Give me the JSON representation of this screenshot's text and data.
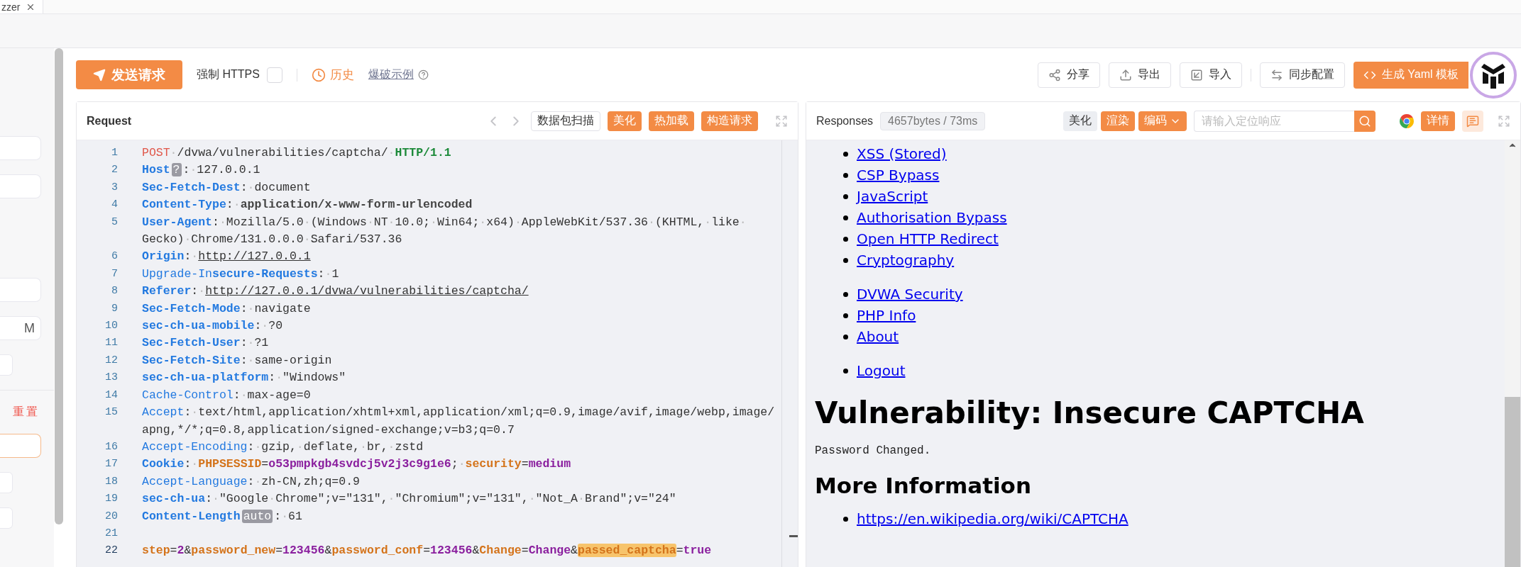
{
  "tab_strip": {
    "tabs": [
      {
        "label": "zzer",
        "selected": true
      }
    ]
  },
  "sidebar": {
    "sections": [
      {
        "items": [
          {
            "kind": "field",
            "focused": false
          },
          {
            "kind": "field",
            "focused": false
          }
        ]
      },
      {
        "items": [
          {
            "kind": "field",
            "focused": false
          },
          {
            "kind": "field",
            "value": "M",
            "focused": false
          },
          {
            "kind": "button"
          }
        ]
      },
      {
        "items": [
          {
            "kind": "link",
            "text": "重置"
          },
          {
            "kind": "field",
            "focused": true
          },
          {
            "kind": "button"
          },
          {
            "kind": "button"
          }
        ]
      }
    ]
  },
  "toolbar": {
    "send_button": "发送请求",
    "force_https": {
      "label": "强制 HTTPS",
      "checked": false
    },
    "history": "历史",
    "examples_link": "爆破示例",
    "actions": [
      {
        "label": "分享",
        "kind": "share"
      },
      {
        "label": "导出",
        "kind": "export"
      },
      {
        "label": "导入",
        "kind": "import"
      },
      {
        "label": "同步配置",
        "kind": "sync"
      }
    ],
    "generate_button": "生成 Yaml 模板"
  },
  "request": {
    "title": "Request",
    "buttons": [
      {
        "label": "数据包扫描",
        "kind": "outline"
      },
      {
        "label": "美化",
        "kind": "primary"
      },
      {
        "label": "热加载",
        "kind": "primary"
      },
      {
        "label": "构造请求",
        "kind": "primary"
      }
    ],
    "lines": [
      {
        "num": "1",
        "active": false,
        "rows": [
          [
            {
              "kind": "method",
              "text": "POST"
            },
            {
              "kind": "val",
              "text": "·/dvwa/vulnerabilities/captcha/·"
            },
            {
              "kind": "proto",
              "text": "HTTP/1.1"
            }
          ]
        ]
      },
      {
        "num": "2",
        "active": false,
        "rows": [
          [
            {
              "kind": "key",
              "text": "Host"
            },
            {
              "kind": "badge",
              "text": "?"
            },
            {
              "kind": "val",
              "text": ":·127.0.0.1"
            }
          ]
        ]
      },
      {
        "num": "3",
        "active": false,
        "rows": [
          [
            {
              "kind": "key",
              "text": "Sec-Fetch-Dest"
            },
            {
              "kind": "val",
              "text": ":·document"
            }
          ]
        ]
      },
      {
        "num": "4",
        "active": false,
        "rows": [
          [
            {
              "kind": "key",
              "text": "Content-Type"
            },
            {
              "kind": "val",
              "text": ":·"
            },
            {
              "kind": "strong",
              "text": "application/x-www-form-urlencoded"
            }
          ]
        ]
      },
      {
        "num": "5",
        "active": false,
        "rows": [
          [
            {
              "kind": "key",
              "text": "User-Agent"
            },
            {
              "kind": "val",
              "text": ":·Mozilla/5.0·(Windows·NT·10.0;·Win64;·x64)·AppleWebKit/537.36·(KHTML,·like·"
            }
          ],
          [
            {
              "kind": "val",
              "text": "Gecko)·Chrome/131.0.0.0·Safari/537.36"
            }
          ]
        ]
      },
      {
        "num": "6",
        "active": false,
        "rows": [
          [
            {
              "kind": "key",
              "text": "Origin"
            },
            {
              "kind": "val",
              "text": ":·"
            },
            {
              "kind": "link",
              "text": "http://127.0.0.1"
            }
          ]
        ]
      },
      {
        "num": "7",
        "active": false,
        "rows": [
          [
            {
              "kind": "key-plain",
              "text": "Upgrade-In"
            },
            {
              "kind": "key",
              "text": "secure-Requests"
            },
            {
              "kind": "val",
              "text": ":·1"
            }
          ]
        ]
      },
      {
        "num": "8",
        "active": false,
        "rows": [
          [
            {
              "kind": "key",
              "text": "Referer"
            },
            {
              "kind": "val",
              "text": ":·"
            },
            {
              "kind": "link",
              "text": "http://127.0.0.1/dvwa/vulnerabilities/captcha/"
            }
          ]
        ]
      },
      {
        "num": "9",
        "active": false,
        "rows": [
          [
            {
              "kind": "key",
              "text": "Sec-Fetch-Mode"
            },
            {
              "kind": "val",
              "text": ":·navigate"
            }
          ]
        ]
      },
      {
        "num": "10",
        "active": false,
        "rows": [
          [
            {
              "kind": "key",
              "text": "sec-ch-ua-mobile"
            },
            {
              "kind": "val",
              "text": ":·?0"
            }
          ]
        ]
      },
      {
        "num": "11",
        "active": false,
        "rows": [
          [
            {
              "kind": "key",
              "text": "Sec-Fetch-User"
            },
            {
              "kind": "val",
              "text": ":·?1"
            }
          ]
        ]
      },
      {
        "num": "12",
        "active": false,
        "rows": [
          [
            {
              "kind": "key",
              "text": "Sec-Fetch-Site"
            },
            {
              "kind": "val",
              "text": ":·same-origin"
            }
          ]
        ]
      },
      {
        "num": "13",
        "active": false,
        "rows": [
          [
            {
              "kind": "key",
              "text": "sec-ch-ua-platform"
            },
            {
              "kind": "val",
              "text": ":·\"Windows\""
            }
          ]
        ]
      },
      {
        "num": "14",
        "active": false,
        "rows": [
          [
            {
              "kind": "key-plain",
              "text": "Cache-Control"
            },
            {
              "kind": "val",
              "text": ":·max-age=0"
            }
          ]
        ]
      },
      {
        "num": "15",
        "active": false,
        "rows": [
          [
            {
              "kind": "key-plain",
              "text": "Accept"
            },
            {
              "kind": "val",
              "text": ":·text/html,application/xhtml+xml,application/xml;q=0.9,image/avif,image/webp,image/"
            }
          ],
          [
            {
              "kind": "val",
              "text": "apng,*/*;q=0.8,application/signed-exchange;v=b3;q=0.7"
            }
          ]
        ]
      },
      {
        "num": "16",
        "active": false,
        "rows": [
          [
            {
              "kind": "key-plain",
              "text": "Accept-Encoding"
            },
            {
              "kind": "val",
              "text": ":·gzip,·deflate,·br,·zstd"
            }
          ]
        ]
      },
      {
        "num": "17",
        "active": false,
        "rows": [
          [
            {
              "kind": "key",
              "text": "Cookie"
            },
            {
              "kind": "val",
              "text": ":·"
            },
            {
              "kind": "param",
              "text": "PHPSESSID"
            },
            {
              "kind": "val",
              "text": "="
            },
            {
              "kind": "value",
              "text": "o53pmpkgb4svdcj5v2j3c9g1e6"
            },
            {
              "kind": "val",
              "text": ";·"
            },
            {
              "kind": "param",
              "text": "security"
            },
            {
              "kind": "val",
              "text": "="
            },
            {
              "kind": "value",
              "text": "medium"
            }
          ]
        ]
      },
      {
        "num": "18",
        "active": false,
        "rows": [
          [
            {
              "kind": "key-plain",
              "text": "Accept-Language"
            },
            {
              "kind": "val",
              "text": ":·zh-CN,zh;q=0.9"
            }
          ]
        ]
      },
      {
        "num": "19",
        "active": false,
        "rows": [
          [
            {
              "kind": "key",
              "text": "sec-ch-ua"
            },
            {
              "kind": "val",
              "text": ":·\"Google·Chrome\";v=\"131\",·\"Chromium\";v=\"131\",·\"Not_A·Brand\";v=\"24\""
            }
          ]
        ]
      },
      {
        "num": "20",
        "active": false,
        "rows": [
          [
            {
              "kind": "key",
              "text": "Content-Length"
            },
            {
              "kind": "badge",
              "text": "auto"
            },
            {
              "kind": "val",
              "text": ":·61"
            }
          ]
        ]
      },
      {
        "num": "21",
        "active": false
      },
      {
        "num": "22",
        "active": true,
        "rows": [
          [
            {
              "kind": "param",
              "text": "step"
            },
            {
              "kind": "val",
              "text": "="
            },
            {
              "kind": "value",
              "text": "2"
            },
            {
              "kind": "val",
              "text": "&"
            },
            {
              "kind": "param",
              "text": "password_new"
            },
            {
              "kind": "val",
              "text": "="
            },
            {
              "kind": "value",
              "text": "123456"
            },
            {
              "kind": "val",
              "text": "&"
            },
            {
              "kind": "param",
              "text": "password_conf"
            },
            {
              "kind": "val",
              "text": "="
            },
            {
              "kind": "value",
              "text": "123456"
            },
            {
              "kind": "val",
              "text": "&"
            },
            {
              "kind": "param",
              "text": "Change"
            },
            {
              "kind": "val",
              "text": "="
            },
            {
              "kind": "value",
              "text": "Change"
            },
            {
              "kind": "val",
              "text": "&"
            },
            {
              "kind": "mark",
              "text": "passed_captcha"
            },
            {
              "kind": "val",
              "text": "="
            },
            {
              "kind": "value",
              "text": "true"
            }
          ]
        ]
      }
    ]
  },
  "response": {
    "title": "Responses",
    "meta": "4657bytes / 73ms",
    "buttons": [
      {
        "label": "美化",
        "kind": "plain"
      },
      {
        "label": "渲染",
        "kind": "primary"
      },
      {
        "label": "编码",
        "kind": "dropdown"
      }
    ],
    "search_placeholder": "请输入定位响应",
    "details_button": "详情",
    "page": {
      "menu_groups": [
        [
          "XSS (Stored)",
          "CSP Bypass",
          "JavaScript",
          "Authorisation Bypass",
          "Open HTTP Redirect",
          "Cryptography"
        ],
        [
          "DVWA Security",
          "PHP Info",
          "About"
        ],
        [
          "Logout"
        ]
      ],
      "title": "Vulnerability: Insecure CAPTCHA",
      "message": "Password Changed.",
      "section_heading": "More Information",
      "more_links": [
        "https://en.wikipedia.org/wiki/CAPTCHA"
      ]
    }
  }
}
